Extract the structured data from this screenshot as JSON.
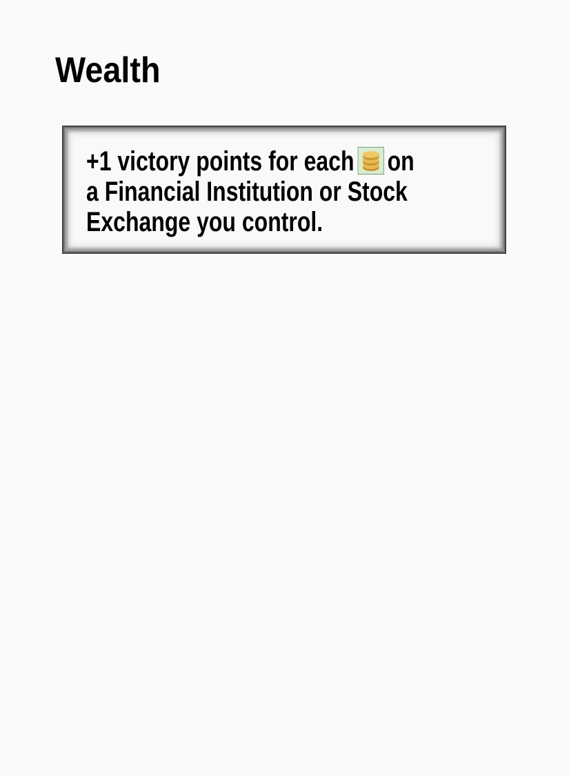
{
  "page": {
    "title": "Wealth"
  },
  "card": {
    "line1_before": "+1 victory points for each",
    "icon": "coins-icon",
    "line1_after": "on",
    "line2": "a Financial Institution or Stock",
    "line3": "Exchange you control."
  },
  "colors": {
    "coin": "#e0b050",
    "icon_bg": "#d8ecd0"
  }
}
